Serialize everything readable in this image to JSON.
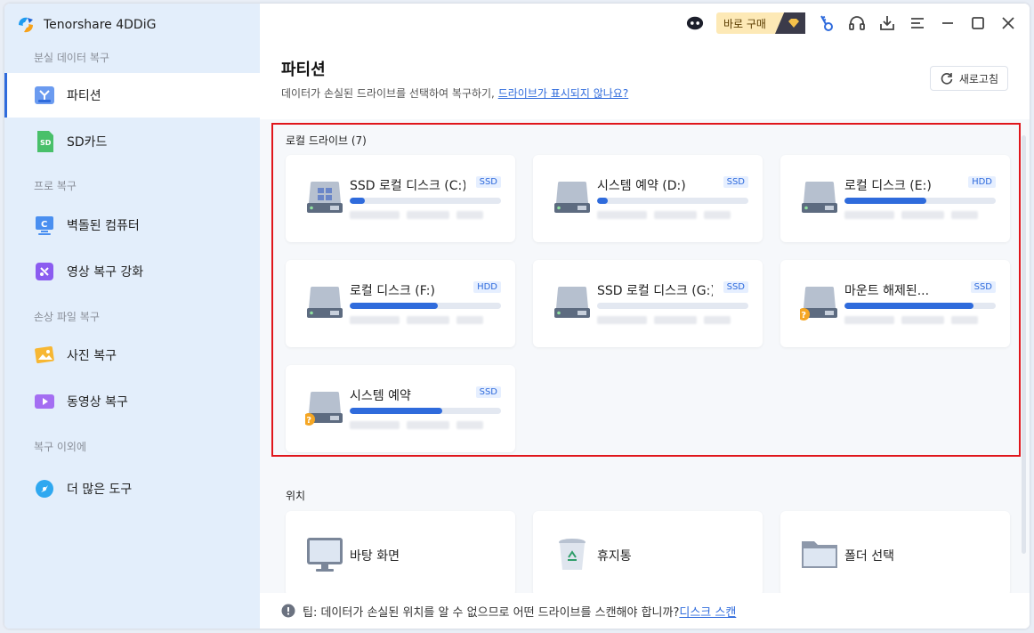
{
  "app": {
    "name": "Tenorshare 4DDiG"
  },
  "sidebar": {
    "sections": [
      {
        "label": "분실 데이터 복구"
      },
      {
        "label": "프로 복구"
      },
      {
        "label": "손상 파일 복구"
      },
      {
        "label": "복구 이외에"
      }
    ],
    "items": [
      {
        "label": "파티션",
        "icon": "partition-icon"
      },
      {
        "label": "SD카드",
        "icon": "sd-card-icon"
      },
      {
        "label": "벽돌된 컴퓨터",
        "icon": "crashed-computer-icon"
      },
      {
        "label": "영상 복구 강화",
        "icon": "video-repair-icon"
      },
      {
        "label": "사진 복구",
        "icon": "photo-icon"
      },
      {
        "label": "동영상 복구",
        "icon": "video-icon"
      },
      {
        "label": "더 많은 도구",
        "icon": "tools-icon"
      }
    ]
  },
  "topbar": {
    "buy_label": "바로 구매"
  },
  "header": {
    "title": "파티션",
    "subtitle": "데이터가 손실된 드라이브를 선택하여 복구하기,",
    "subtitle_link": "드라이브가 표시되지 않나요?",
    "refresh_label": "새로고침"
  },
  "local_drives": {
    "label": "로컬 드라이브 (7)",
    "drives": [
      {
        "name": "SSD 로컬 디스크 (C:)",
        "type": "SSD",
        "usage": 0.1,
        "windows": true,
        "warning": false
      },
      {
        "name": "시스템 예약 (D:)",
        "type": "SSD",
        "usage": 0.07,
        "windows": false,
        "warning": false
      },
      {
        "name": "로컬 디스크 (E:)",
        "type": "HDD",
        "usage": 0.54,
        "windows": false,
        "warning": false
      },
      {
        "name": "로컬 디스크 (F:)",
        "type": "HDD",
        "usage": 0.58,
        "windows": false,
        "warning": false
      },
      {
        "name": "SSD 로컬 디스크 (G:)",
        "type": "SSD",
        "usage": 0.0,
        "windows": false,
        "warning": false
      },
      {
        "name": "마운트 해제된...",
        "type": "SSD",
        "usage": 0.85,
        "windows": false,
        "warning": true
      },
      {
        "name": "시스템 예약",
        "type": "SSD",
        "usage": 0.61,
        "windows": false,
        "warning": true
      }
    ]
  },
  "locations": {
    "label": "위치",
    "items": [
      {
        "name": "바탕 화면",
        "icon": "desktop-icon"
      },
      {
        "name": "휴지통",
        "icon": "recycle-bin-icon"
      },
      {
        "name": "폴더 선택",
        "icon": "folder-icon"
      }
    ]
  },
  "tip": {
    "text": "팁: 데이터가 손실된 위치를 알 수 없으므로 어떤 드라이브를 스캔해야 합니까?",
    "link": "디스크 스캔"
  },
  "colors": {
    "accent": "#2f6bdc",
    "highlight": "#e0161c"
  }
}
